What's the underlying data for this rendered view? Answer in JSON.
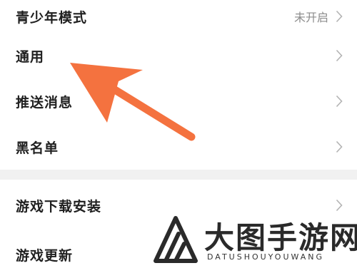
{
  "settings": {
    "group1": [
      {
        "label": "青少年模式",
        "value": "未开启"
      },
      {
        "label": "通用"
      },
      {
        "label": "推送消息"
      },
      {
        "label": "黑名单"
      }
    ],
    "group2": [
      {
        "label": "游戏下载安装"
      },
      {
        "label": "游戏更新"
      }
    ]
  },
  "icons": {
    "chevron": "chevron-right-icon",
    "annotation": "arrow-icon"
  },
  "colors": {
    "annotation_arrow": "#f4723f",
    "separator": "#f1f1f1",
    "chevron": "#b3b3b3"
  },
  "watermark": {
    "title": "大图手游网",
    "subtitle": "DATUSHOUYOUWANG"
  }
}
